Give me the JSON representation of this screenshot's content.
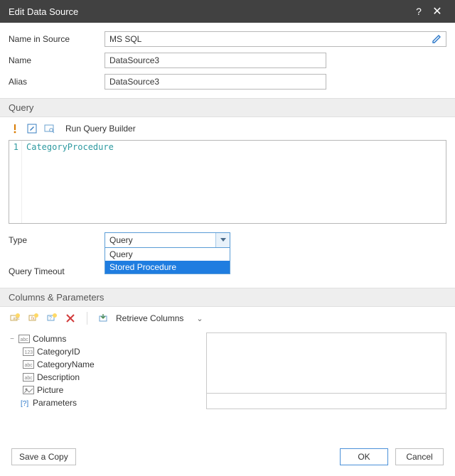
{
  "title": "Edit Data Source",
  "fields": {
    "name_in_source": {
      "label": "Name in Source",
      "value": "MS SQL"
    },
    "name": {
      "label": "Name",
      "value": "DataSource3"
    },
    "alias": {
      "label": "Alias",
      "value": "DataSource3"
    },
    "type": {
      "label": "Type",
      "value": "Query",
      "options": [
        "Query",
        "Stored Procedure"
      ],
      "selected_index": 1
    },
    "query_timeout": {
      "label": "Query Timeout",
      "value": ""
    }
  },
  "sections": {
    "query": "Query",
    "columns": "Columns & Parameters"
  },
  "query_tools": {
    "run_builder": "Run Query Builder"
  },
  "code": {
    "line_number": "1",
    "text": "CategoryProcedure"
  },
  "col_tools": {
    "retrieve": "Retrieve Columns"
  },
  "tree": {
    "root": "Columns",
    "children": [
      "CategoryID",
      "CategoryName",
      "Description",
      "Picture"
    ],
    "params": "Parameters"
  },
  "buttons": {
    "save_copy": "Save a Copy",
    "ok": "OK",
    "cancel": "Cancel"
  }
}
